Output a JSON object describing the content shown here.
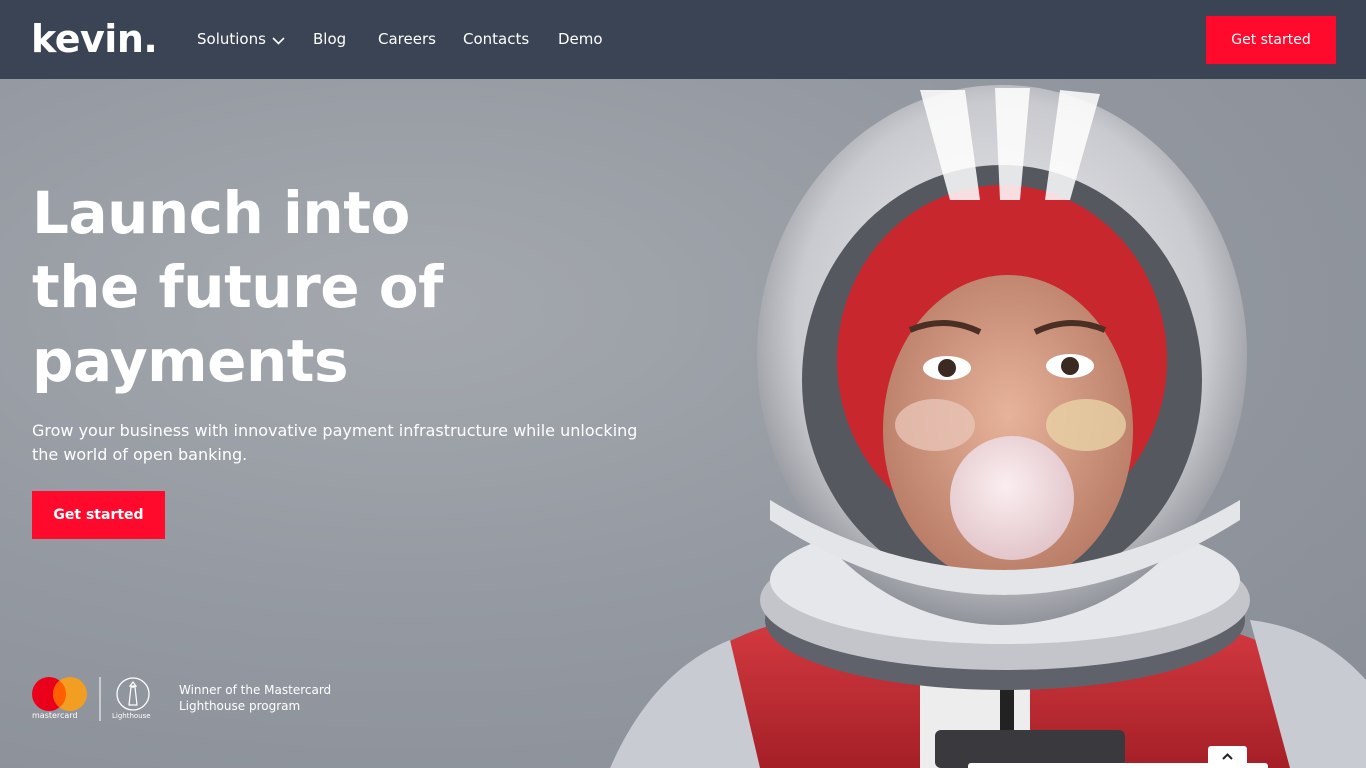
{
  "brand": {
    "logo_text": "kevin."
  },
  "nav": {
    "items": [
      {
        "label": "Solutions",
        "has_dropdown": true
      },
      {
        "label": "Blog"
      },
      {
        "label": "Careers"
      },
      {
        "label": "Contacts"
      },
      {
        "label": "Demo"
      }
    ],
    "cta_label": "Get started"
  },
  "hero": {
    "headline_lines": [
      "Launch into",
      "the future of",
      "payments"
    ],
    "subtext_lines": [
      "Grow your business with innovative payment infrastructure while unlocking",
      "the world of open banking."
    ],
    "cta_label": "Get started"
  },
  "award": {
    "mastercard_label": "mastercard",
    "lighthouse_label": "Lighthouse",
    "text_lines": [
      "Winner of the Mastercard",
      "Lighthouse program"
    ]
  },
  "colors": {
    "navbar": "#3b4454",
    "accent": "#ff0a2c",
    "background": "#959aa2"
  },
  "icons": {
    "dropdown": "chevron-down-icon",
    "scroll_top": "chevron-up-icon"
  }
}
